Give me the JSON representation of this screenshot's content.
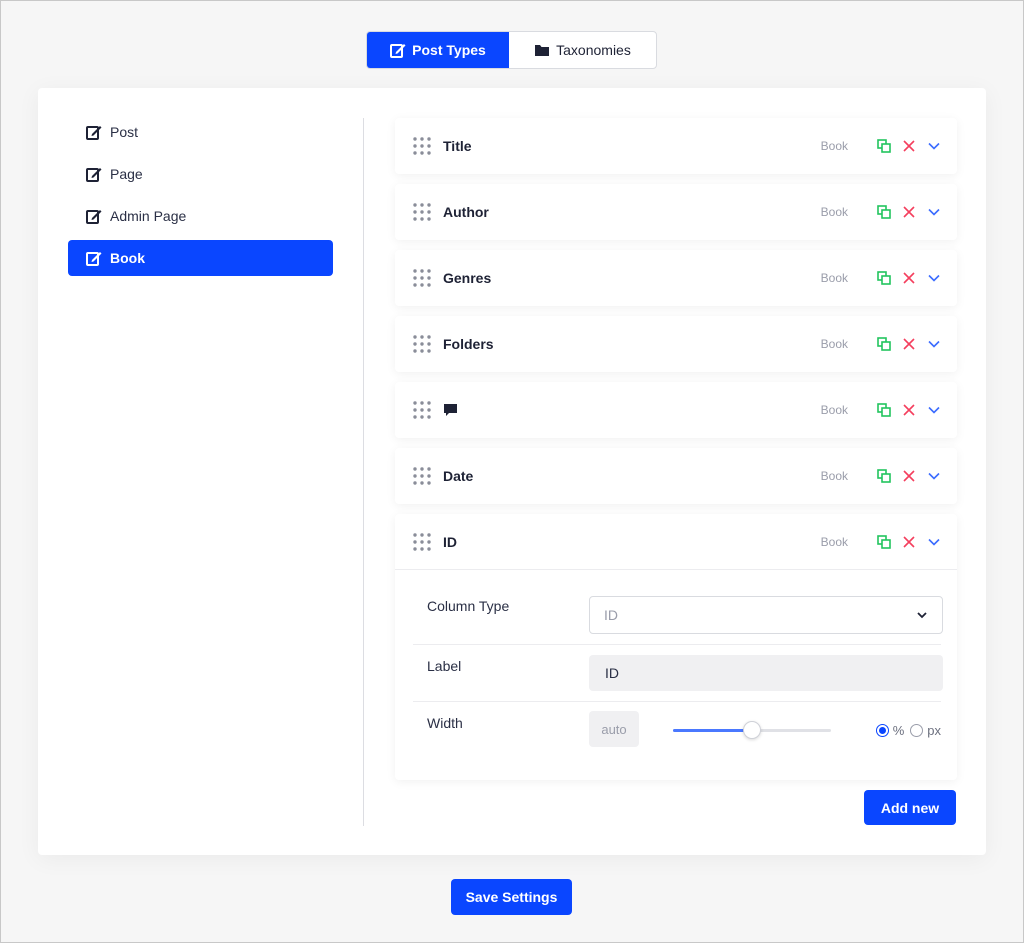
{
  "top_tabs": [
    {
      "label": "Post Types",
      "icon": "edit-icon",
      "active": true
    },
    {
      "label": "Taxonomies",
      "icon": "folder-icon",
      "active": false
    }
  ],
  "sidebar": {
    "items": [
      {
        "label": "Post",
        "icon": "edit-icon",
        "active": false
      },
      {
        "label": "Page",
        "icon": "edit-icon",
        "active": false
      },
      {
        "label": "Admin Page",
        "icon": "edit-icon",
        "active": false
      },
      {
        "label": "Book",
        "icon": "edit-icon",
        "active": true
      }
    ]
  },
  "columns": [
    {
      "label": "Title",
      "type": "Book"
    },
    {
      "label": "Author",
      "type": "Book"
    },
    {
      "label": "Genres",
      "type": "Book"
    },
    {
      "label": "Folders",
      "type": "Book"
    },
    {
      "label": "",
      "type": "Book",
      "icon": "comment-icon"
    },
    {
      "label": "Date",
      "type": "Book"
    },
    {
      "label": "ID",
      "type": "Book",
      "expanded": true
    }
  ],
  "expanded_form": {
    "column_type_label": "Column Type",
    "column_type_value": "ID",
    "label_label": "Label",
    "label_value": "ID",
    "width_label": "Width",
    "width_value": "auto",
    "width_slider_fraction": 0.5,
    "unit_percent": "%",
    "unit_px": "px",
    "selected_unit": "%"
  },
  "buttons": {
    "add_new": "Add new",
    "save_settings": "Save Settings"
  },
  "colors": {
    "primary": "#0a46ff",
    "clone": "#22c55e",
    "delete": "#f43f5e",
    "chevron": "#3b6cff"
  }
}
